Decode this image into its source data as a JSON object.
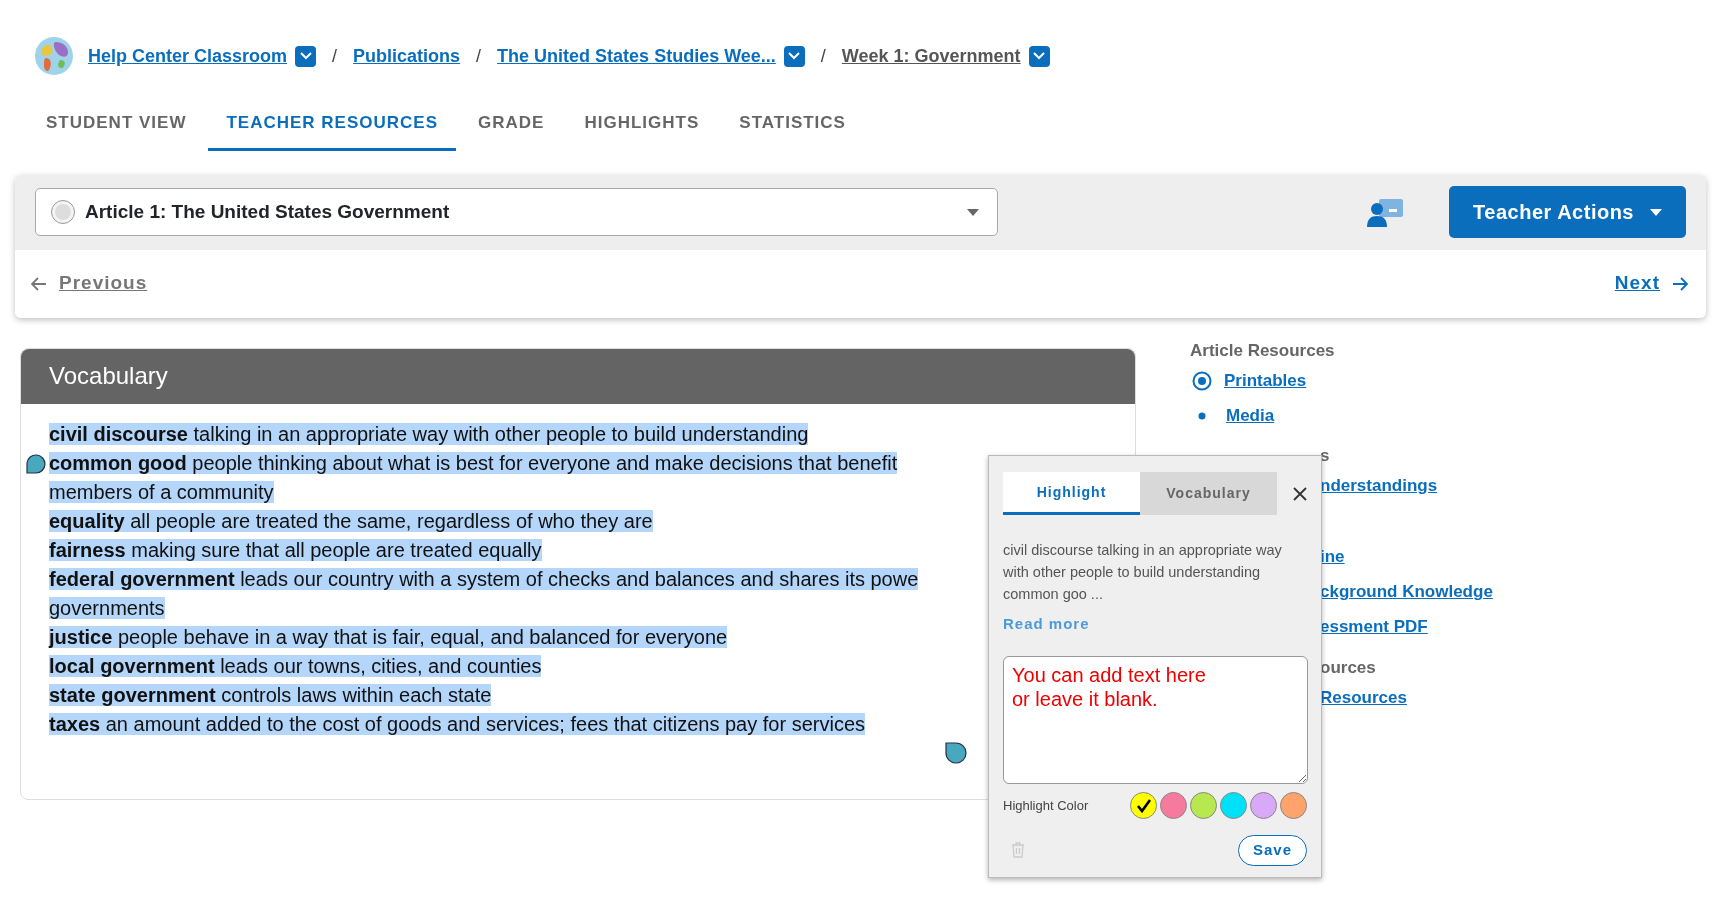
{
  "breadcrumb": [
    {
      "label": "Help Center Classroom",
      "dropdown": true,
      "current": false
    },
    {
      "label": "Publications",
      "dropdown": false,
      "current": false
    },
    {
      "label": "The United States Studies Wee...",
      "dropdown": true,
      "current": false
    },
    {
      "label": "Week 1: Government",
      "dropdown": true,
      "current": true
    }
  ],
  "breadcrumb_separator": "/",
  "tabs": [
    {
      "label": "STUDENT VIEW",
      "selected": false
    },
    {
      "label": "TEACHER RESOURCES",
      "selected": true
    },
    {
      "label": "GRADE",
      "selected": false
    },
    {
      "label": "HIGHLIGHTS",
      "selected": false
    },
    {
      "label": "STATISTICS",
      "selected": false
    }
  ],
  "article_select": {
    "value": "Article 1: The United States Government"
  },
  "teacher_actions": {
    "label": "Teacher Actions"
  },
  "pager": {
    "previous": "Previous",
    "next": "Next"
  },
  "vocabulary": {
    "title": "Vocabulary",
    "lines": [
      {
        "term": "civil discourse",
        "text": "talking in an appropriate way with other people to build understanding"
      },
      {
        "term": "common good",
        "text": "people thinking about what is best for everyone and make decisions that benefit"
      },
      {
        "text": "members of a community"
      },
      {
        "term": "equality",
        "text": "all people are treated the same, regardless of who they are"
      },
      {
        "term": "fairness",
        "text": "making sure that all people are treated equally"
      },
      {
        "term": "federal government",
        "text": "leads our country with a system of checks and balances and shares its powe"
      },
      {
        "text": "governments"
      },
      {
        "term": "justice",
        "text": "people behave in a way that is fair, equal, and balanced for everyone"
      },
      {
        "term": "local government",
        "text": "leads our towns, cities, and counties"
      },
      {
        "term": "state government",
        "text": "controls laws within each state"
      },
      {
        "term": "taxes",
        "text": "an amount added to the cost of goods and services; fees that citizens pay for services"
      }
    ]
  },
  "sidebar": {
    "groups": [
      {
        "heading": "Article Resources",
        "covered": false,
        "items": [
          {
            "label": "Printables",
            "kind": "ring"
          },
          {
            "label": "Media",
            "kind": "dot"
          }
        ]
      },
      {
        "heading": "s",
        "covered": true,
        "items": [
          {
            "label": "nderstandings"
          }
        ]
      },
      {
        "covered": true,
        "items": [
          {
            "label": "ine"
          },
          {
            "label": "ckground Knowledge"
          },
          {
            "label": "essment PDF"
          }
        ]
      },
      {
        "heading": "ources",
        "covered": true,
        "items": [
          {
            "label": "Resources"
          }
        ]
      }
    ]
  },
  "popup": {
    "tabs": [
      {
        "label": "Highlight",
        "selected": true
      },
      {
        "label": "Vocabulary",
        "selected": false
      }
    ],
    "excerpt": "civil discourse talking in an appropriate way with other people to build understanding common goo ...",
    "read_more": "Read more",
    "note": "You can add text here\nor leave it blank.",
    "color_label": "Highlight Color",
    "colors": [
      {
        "color": "#ffff00",
        "selected": true
      },
      {
        "color": "#f57a9c",
        "selected": false
      },
      {
        "color": "#b8e84f",
        "selected": false
      },
      {
        "color": "#00e1f8",
        "selected": false
      },
      {
        "color": "#d7a9f7",
        "selected": false
      },
      {
        "color": "#ffa36c",
        "selected": false
      }
    ],
    "save": "Save"
  }
}
